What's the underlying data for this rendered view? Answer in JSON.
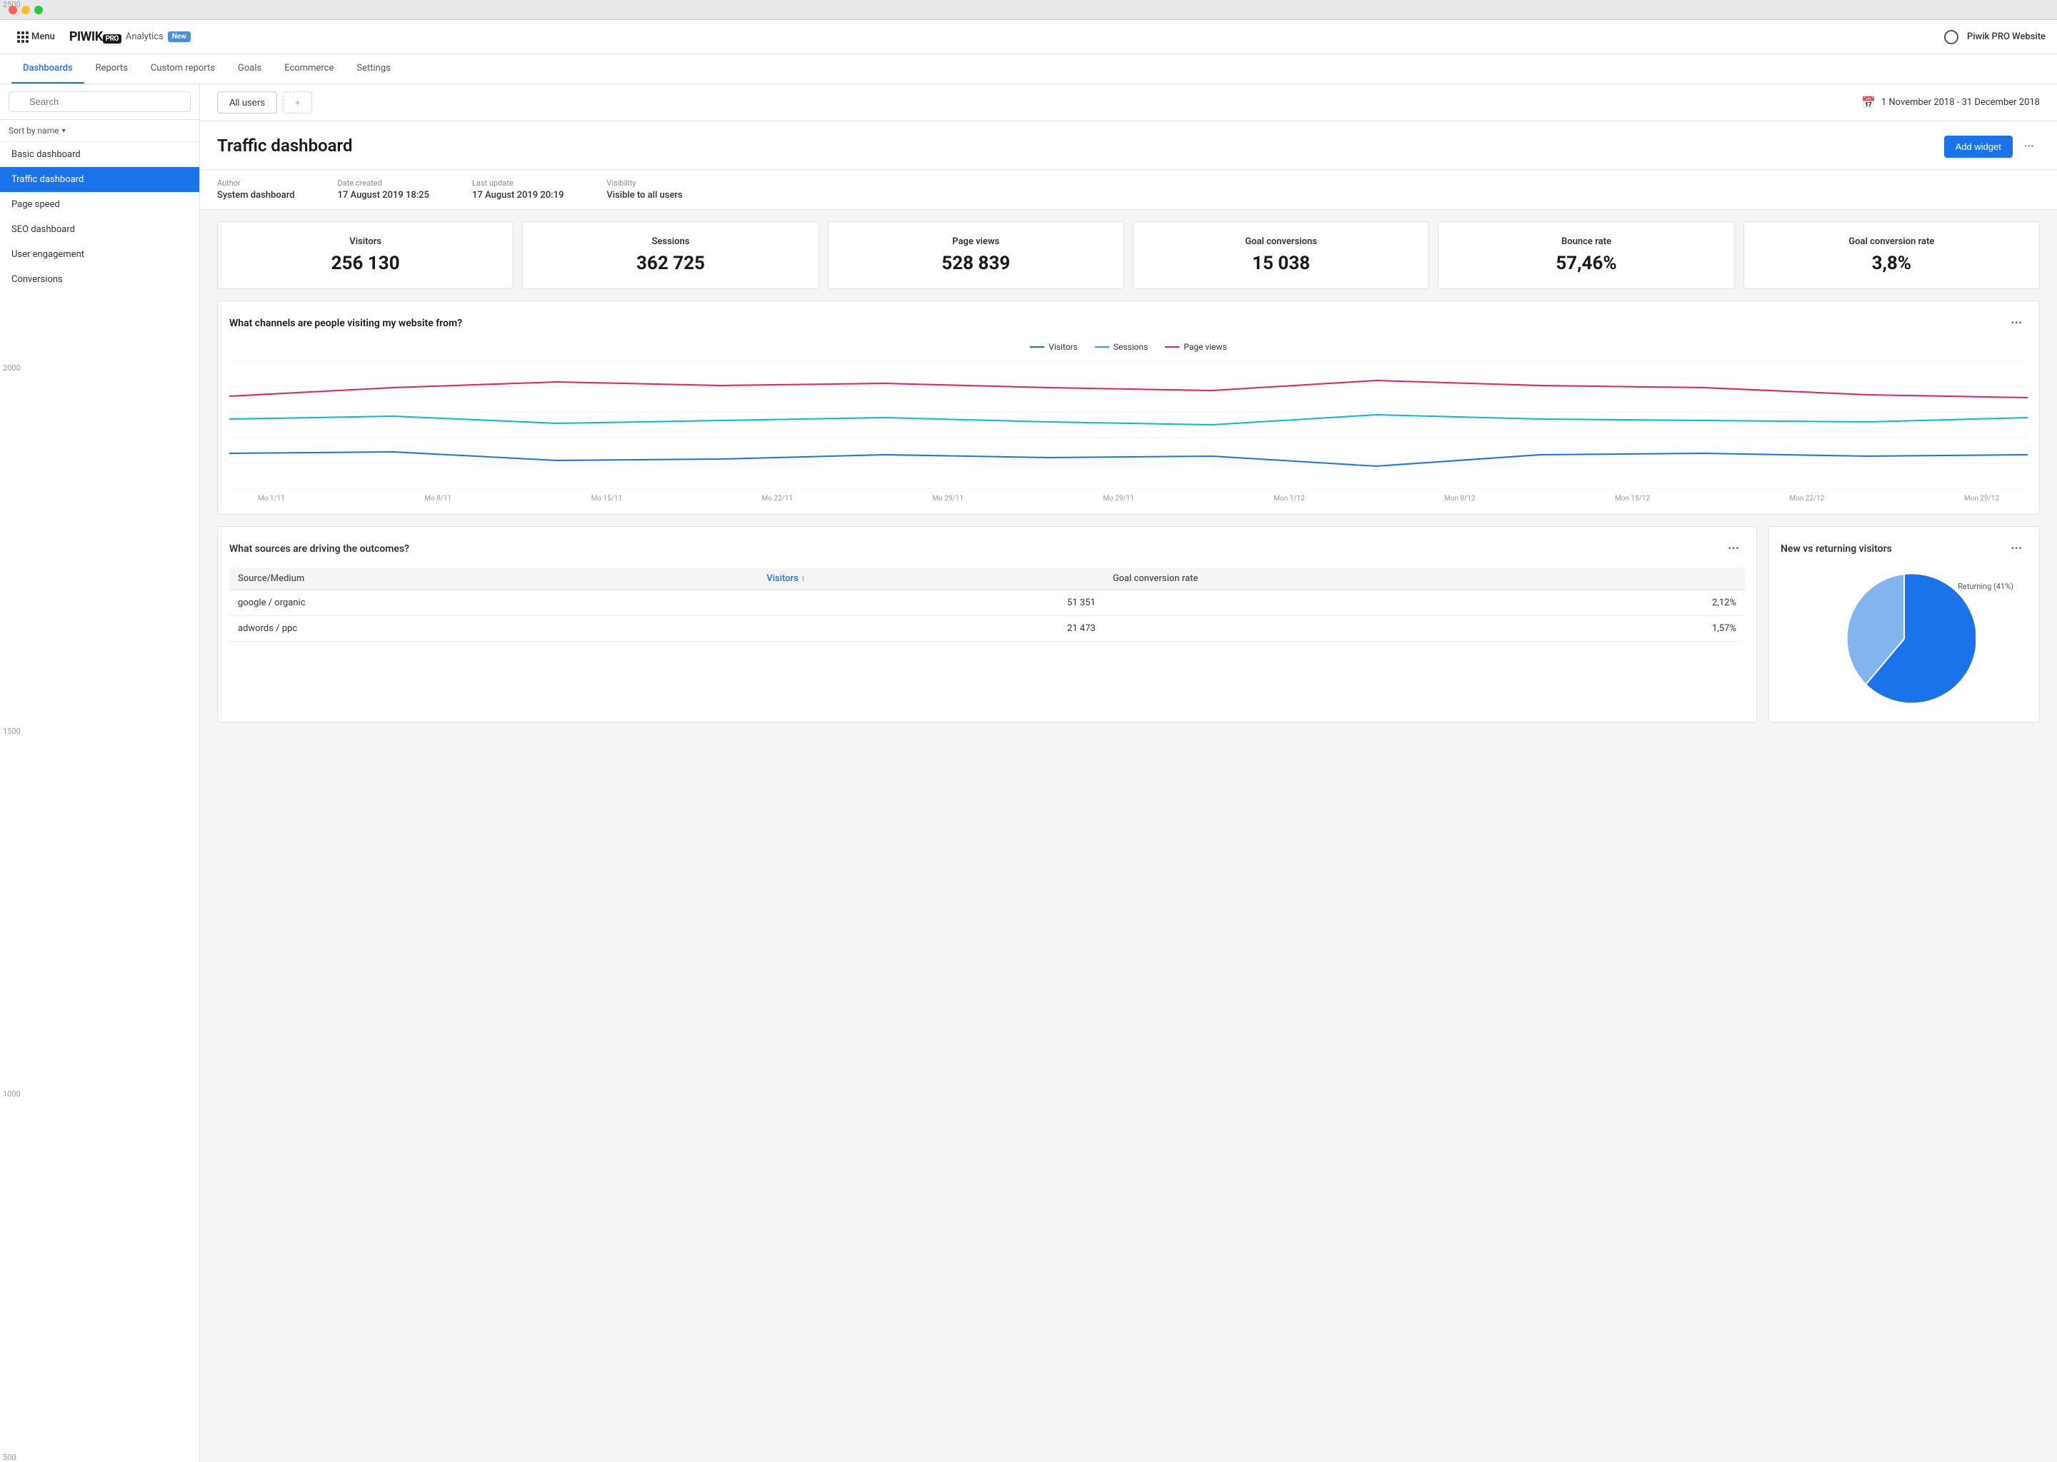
{
  "window": {
    "title": "Piwik PRO Website"
  },
  "topbar": {
    "menu_label": "Menu",
    "logo_text": "PIWIK",
    "logo_pro": "PRO",
    "analytics_label": "Analytics",
    "new_badge": "New",
    "site_name": "Piwik PRO Website"
  },
  "nav_tabs": [
    {
      "id": "dashboards",
      "label": "Dashboards",
      "active": true
    },
    {
      "id": "reports",
      "label": "Reports",
      "active": false
    },
    {
      "id": "custom_reports",
      "label": "Custom reports",
      "active": false
    },
    {
      "id": "goals",
      "label": "Goals",
      "active": false
    },
    {
      "id": "ecommerce",
      "label": "Ecommerce",
      "active": false
    },
    {
      "id": "settings",
      "label": "Settings",
      "active": false
    }
  ],
  "sidebar": {
    "search_placeholder": "Search",
    "sort_label": "Sort by name",
    "items": [
      {
        "id": "basic",
        "label": "Basic dashboard",
        "active": false
      },
      {
        "id": "traffic",
        "label": "Traffic dashboard",
        "active": true
      },
      {
        "id": "pagespeed",
        "label": "Page speed",
        "active": false
      },
      {
        "id": "seo",
        "label": "SEO dashboard",
        "active": false
      },
      {
        "id": "engagement",
        "label": "User engagement",
        "active": false
      },
      {
        "id": "conversions",
        "label": "Conversions",
        "active": false
      }
    ]
  },
  "content_top": {
    "segment_label": "All users",
    "add_segment_label": "+",
    "date_range": "1 November 2018 - 31 December 2018"
  },
  "dashboard": {
    "title": "Traffic dashboard",
    "add_widget_label": "Add widget",
    "meta": {
      "author_label": "Author",
      "author_value": "System dashboard",
      "date_created_label": "Date created",
      "date_created_value": "17 August 2019 18:25",
      "last_update_label": "Last update",
      "last_update_value": "17 August 2019 20:19",
      "visibility_label": "Visibility",
      "visibility_value": "Visible to all users"
    }
  },
  "stats": [
    {
      "id": "visitors",
      "label": "Visitors",
      "value": "256 130"
    },
    {
      "id": "sessions",
      "label": "Sessions",
      "value": "362 725"
    },
    {
      "id": "pageviews",
      "label": "Page views",
      "value": "528 839"
    },
    {
      "id": "goal_conversions",
      "label": "Goal conversions",
      "value": "15 038"
    },
    {
      "id": "bounce_rate",
      "label": "Bounce rate",
      "value": "57,46%"
    },
    {
      "id": "goal_conversion_rate",
      "label": "Goal conversion rate",
      "value": "3,8%"
    }
  ],
  "chart": {
    "title": "What channels are people visiting my website from?",
    "legend": [
      {
        "label": "Visitors",
        "color": "#1a73e8",
        "class": "visitors"
      },
      {
        "label": "Sessions",
        "color": "#00bcd4",
        "class": "sessions"
      },
      {
        "label": "Page views",
        "color": "#e91e63",
        "class": "pageviews"
      }
    ],
    "y_labels": [
      "2500",
      "2000",
      "1500",
      "1000",
      "500"
    ],
    "x_labels": [
      "Mo 1/11",
      "Mo 8/11",
      "Mo 15/11",
      "Mo 22/11",
      "Mo 29/11",
      "Mo 29/11",
      "Mon 1/12",
      "Mon 8/12",
      "Mon 15/12",
      "Mon 22/12",
      "Mon 29/12"
    ]
  },
  "sources_table": {
    "title": "What sources are driving the outcomes?",
    "columns": [
      "Source/Medium",
      "Visitors",
      "Goal conversion rate"
    ],
    "rows": [
      {
        "source": "google / organic",
        "visitors": "51 351",
        "rate": "2,12%"
      },
      {
        "source": "adwords / ppc",
        "visitors": "21 473",
        "rate": "1,57%"
      }
    ]
  },
  "pie_chart": {
    "title": "New vs returning visitors",
    "returning_label": "Returning (41%)",
    "returning_pct": 41,
    "new_pct": 59
  }
}
